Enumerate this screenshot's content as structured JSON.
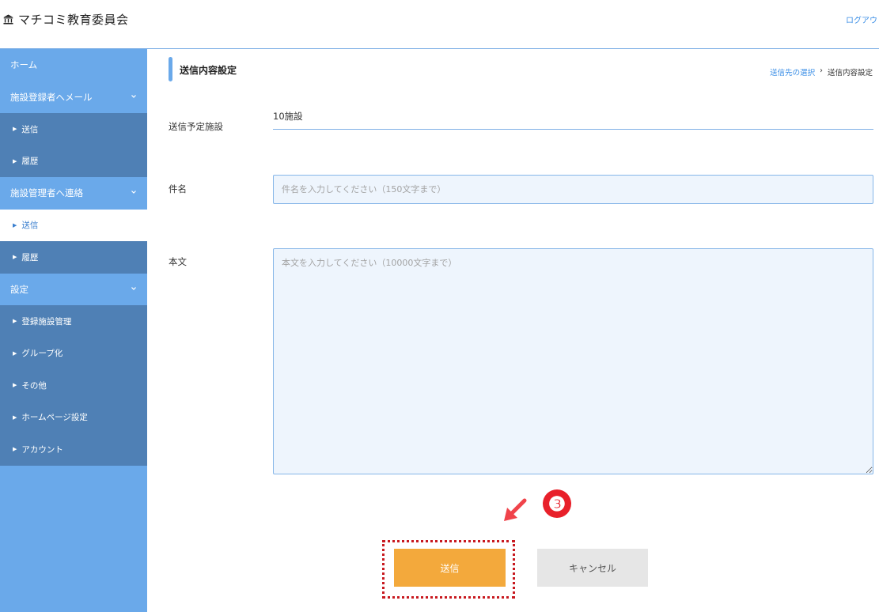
{
  "header": {
    "title": "マチコミ教育委員会",
    "logout": "ログアウ",
    "brand_icon": "building-icon"
  },
  "sidebar": {
    "home": "ホーム",
    "group1": "施設登録者へメール",
    "group1_items": [
      "送信",
      "履歴"
    ],
    "group2": "施設管理者へ連絡",
    "group2_items": [
      "送信",
      "履歴"
    ],
    "group3": "設定",
    "group3_items": [
      "登録施設管理",
      "グループ化",
      "その他",
      "ホームページ設定",
      "アカウント"
    ]
  },
  "main": {
    "section_title": "送信内容設定",
    "breadcrumb_link": "送信先の選択",
    "breadcrumb_sep": "›",
    "breadcrumb_current": "送信内容設定",
    "facility_label": "送信予定施設",
    "facility_value": "10施設",
    "subject_label": "件名",
    "subject_placeholder": "件名を入力してください（150文字まで）",
    "body_label": "本文",
    "body_placeholder": "本文を入力してください（10000文字まで）",
    "send_button": "送信",
    "cancel_button": "キャンセル",
    "annotation_number": "❸"
  },
  "colors": {
    "sidebar": "#6aa9ea",
    "sidebar_sub": "#4f80b5",
    "accent": "#3a8ee6",
    "send": "#f3a93c",
    "annotation": "#e8202a"
  }
}
